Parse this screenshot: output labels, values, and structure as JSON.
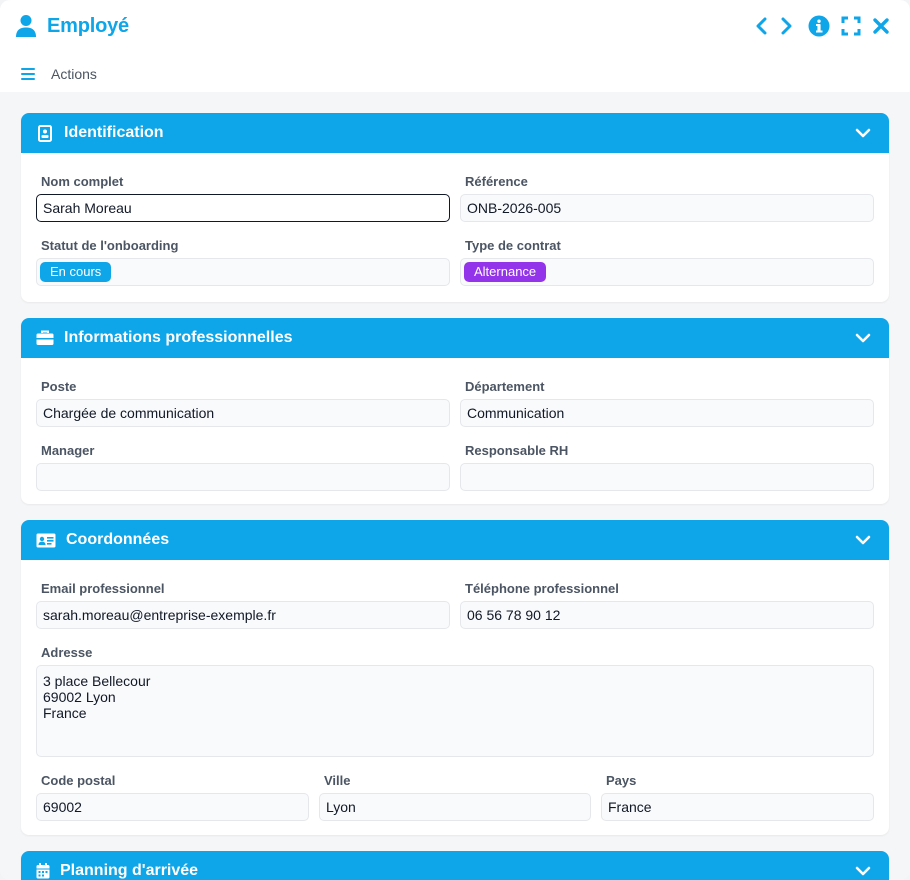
{
  "window": {
    "title": "Employé",
    "actions_label": "Actions"
  },
  "icons": {
    "title": "user-icon",
    "prev": "chevron-left-icon",
    "next": "chevron-right-icon",
    "info": "info-icon",
    "fullscreen": "expand-icon",
    "close": "close-icon",
    "menu": "hamburger-icon"
  },
  "colors": {
    "accent": "#0ea5e9",
    "badge_en_cours": "#0ea5e9",
    "badge_alternance": "#9333ea"
  },
  "identification": {
    "title": "Identification",
    "nom_label": "Nom complet",
    "nom_value": "Sarah Moreau",
    "ref_label": "Référence",
    "ref_value": "ONB-2026-005",
    "statut_label": "Statut de l'onboarding",
    "statut_value": "En cours",
    "contrat_label": "Type de contrat",
    "contrat_value": "Alternance"
  },
  "pro": {
    "title": "Informations professionnelles",
    "poste_label": "Poste",
    "poste_value": "Chargée de communication",
    "dept_label": "Département",
    "dept_value": "Communication",
    "manager_label": "Manager",
    "manager_value": "",
    "rh_label": "Responsable RH",
    "rh_value": ""
  },
  "coord": {
    "title": "Coordonnées",
    "email_label": "Email professionnel",
    "email_value": "sarah.moreau@entreprise-exemple.fr",
    "tel_label": "Téléphone professionnel",
    "tel_value": "06 56 78 90 12",
    "adresse_label": "Adresse",
    "adresse_value": "3 place Bellecour\n69002 Lyon\nFrance",
    "cp_label": "Code postal",
    "cp_value": "69002",
    "ville_label": "Ville",
    "ville_value": "Lyon",
    "pays_label": "Pays",
    "pays_value": "France"
  },
  "planning": {
    "title": "Planning d'arrivée"
  }
}
